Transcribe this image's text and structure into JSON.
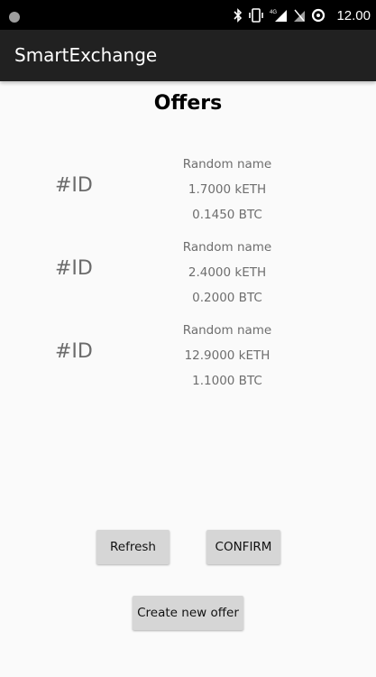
{
  "status_bar": {
    "time": "12.00",
    "icons": [
      "bluetooth-icon",
      "vibrate-icon",
      "signal-4g-icon",
      "no-sim-icon",
      "data-saver-icon"
    ],
    "network_label": "4G",
    "background": "#000000"
  },
  "app_bar": {
    "title": "SmartExchange",
    "background": "#212121"
  },
  "page": {
    "title": "Offers"
  },
  "offers": [
    {
      "id": "#ID",
      "name": "Random name",
      "eth": "1.7000 kETH",
      "btc": "0.1450 BTC"
    },
    {
      "id": "#ID",
      "name": "Random name",
      "eth": "2.4000 kETH",
      "btc": "0.2000 BTC"
    },
    {
      "id": "#ID",
      "name": "Random name",
      "eth": "12.9000 kETH",
      "btc": "1.1000 BTC"
    }
  ],
  "actions": {
    "refresh_label": "Refresh",
    "confirm_label": "CONFIRM",
    "create_label": "Create new offer"
  },
  "colors": {
    "background": "#fafafa",
    "button": "#d6d6d6",
    "secondary_text": "#6e6e6e"
  }
}
